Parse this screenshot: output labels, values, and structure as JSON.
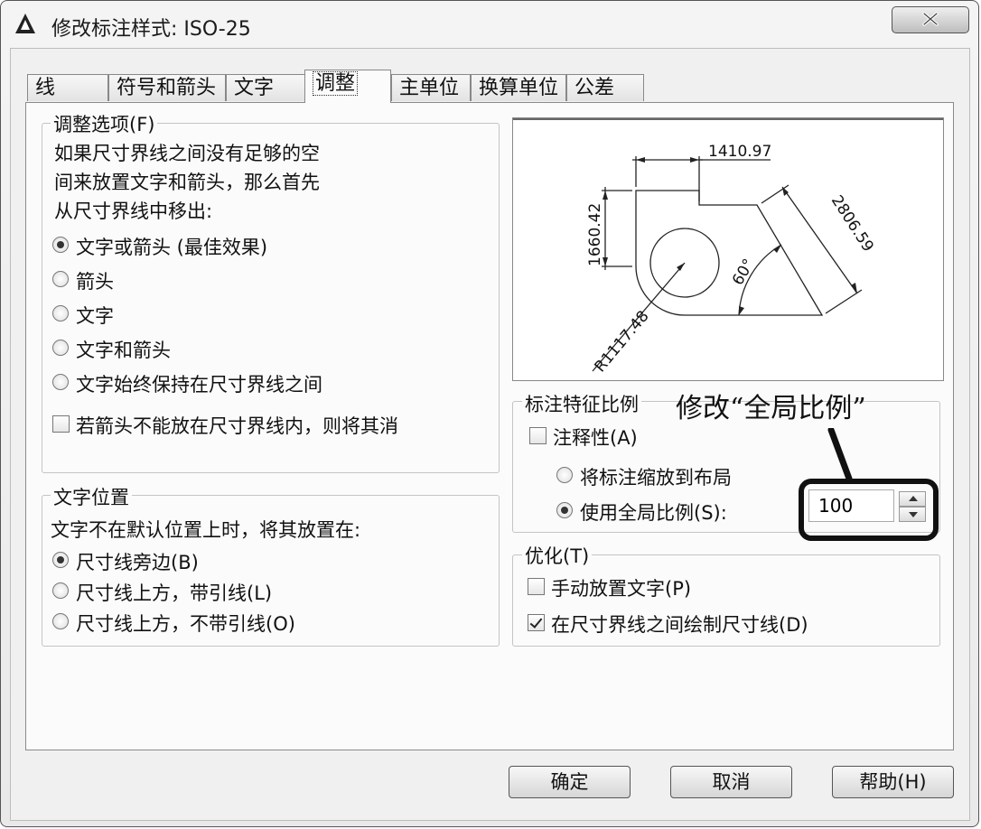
{
  "window": {
    "title": "修改标注样式: ISO-25"
  },
  "tabs": [
    {
      "label": "线"
    },
    {
      "label": "符号和箭头"
    },
    {
      "label": "文字"
    },
    {
      "label": "调整"
    },
    {
      "label": "主单位"
    },
    {
      "label": "换算单位"
    },
    {
      "label": "公差"
    }
  ],
  "fit_options": {
    "legend": "调整选项(F)",
    "description_lines": [
      "如果尺寸界线之间没有足够的空",
      "间来放置文字和箭头，那么首先",
      "从尺寸界线中移出:"
    ],
    "radios": [
      {
        "label": "文字或箭头 (最佳效果)",
        "selected": true
      },
      {
        "label": "箭头",
        "selected": false
      },
      {
        "label": "文字",
        "selected": false
      },
      {
        "label": "文字和箭头",
        "selected": false
      },
      {
        "label": "文字始终保持在尺寸界线之间",
        "selected": false
      }
    ],
    "suppress_checkbox": {
      "label": "若箭头不能放在尺寸界线内，则将其消",
      "checked": false
    }
  },
  "text_placement": {
    "legend": "文字位置",
    "description": "文字不在默认位置上时，将其放置在:",
    "radios": [
      {
        "label": "尺寸线旁边(B)",
        "selected": true
      },
      {
        "label": "尺寸线上方，带引线(L)",
        "selected": false
      },
      {
        "label": "尺寸线上方，不带引线(O)",
        "selected": false
      }
    ]
  },
  "preview": {
    "dim_horizontal": "1410.97",
    "dim_vertical": "1660.42",
    "dim_aligned": "2806.59",
    "dim_angle": "60°",
    "dim_radius": "R1117.48"
  },
  "scale": {
    "legend": "标注特征比例",
    "annotative": {
      "label": "注释性(A)",
      "checked": false
    },
    "scale_to_layout": {
      "label": "将标注缩放到布局",
      "selected": false
    },
    "use_overall": {
      "label": "使用全局比例(S):",
      "selected": true
    },
    "overall_value": "100"
  },
  "annotation": {
    "text": "修改“全局比例”"
  },
  "fine_tuning": {
    "legend": "优化(T)",
    "manual_text": {
      "label": "手动放置文字(P)",
      "checked": false
    },
    "draw_dim_line": {
      "label": "在尺寸界线之间绘制尺寸线(D)",
      "checked": true
    }
  },
  "buttons": {
    "ok": "确定",
    "cancel": "取消",
    "help": "帮助(H)"
  }
}
